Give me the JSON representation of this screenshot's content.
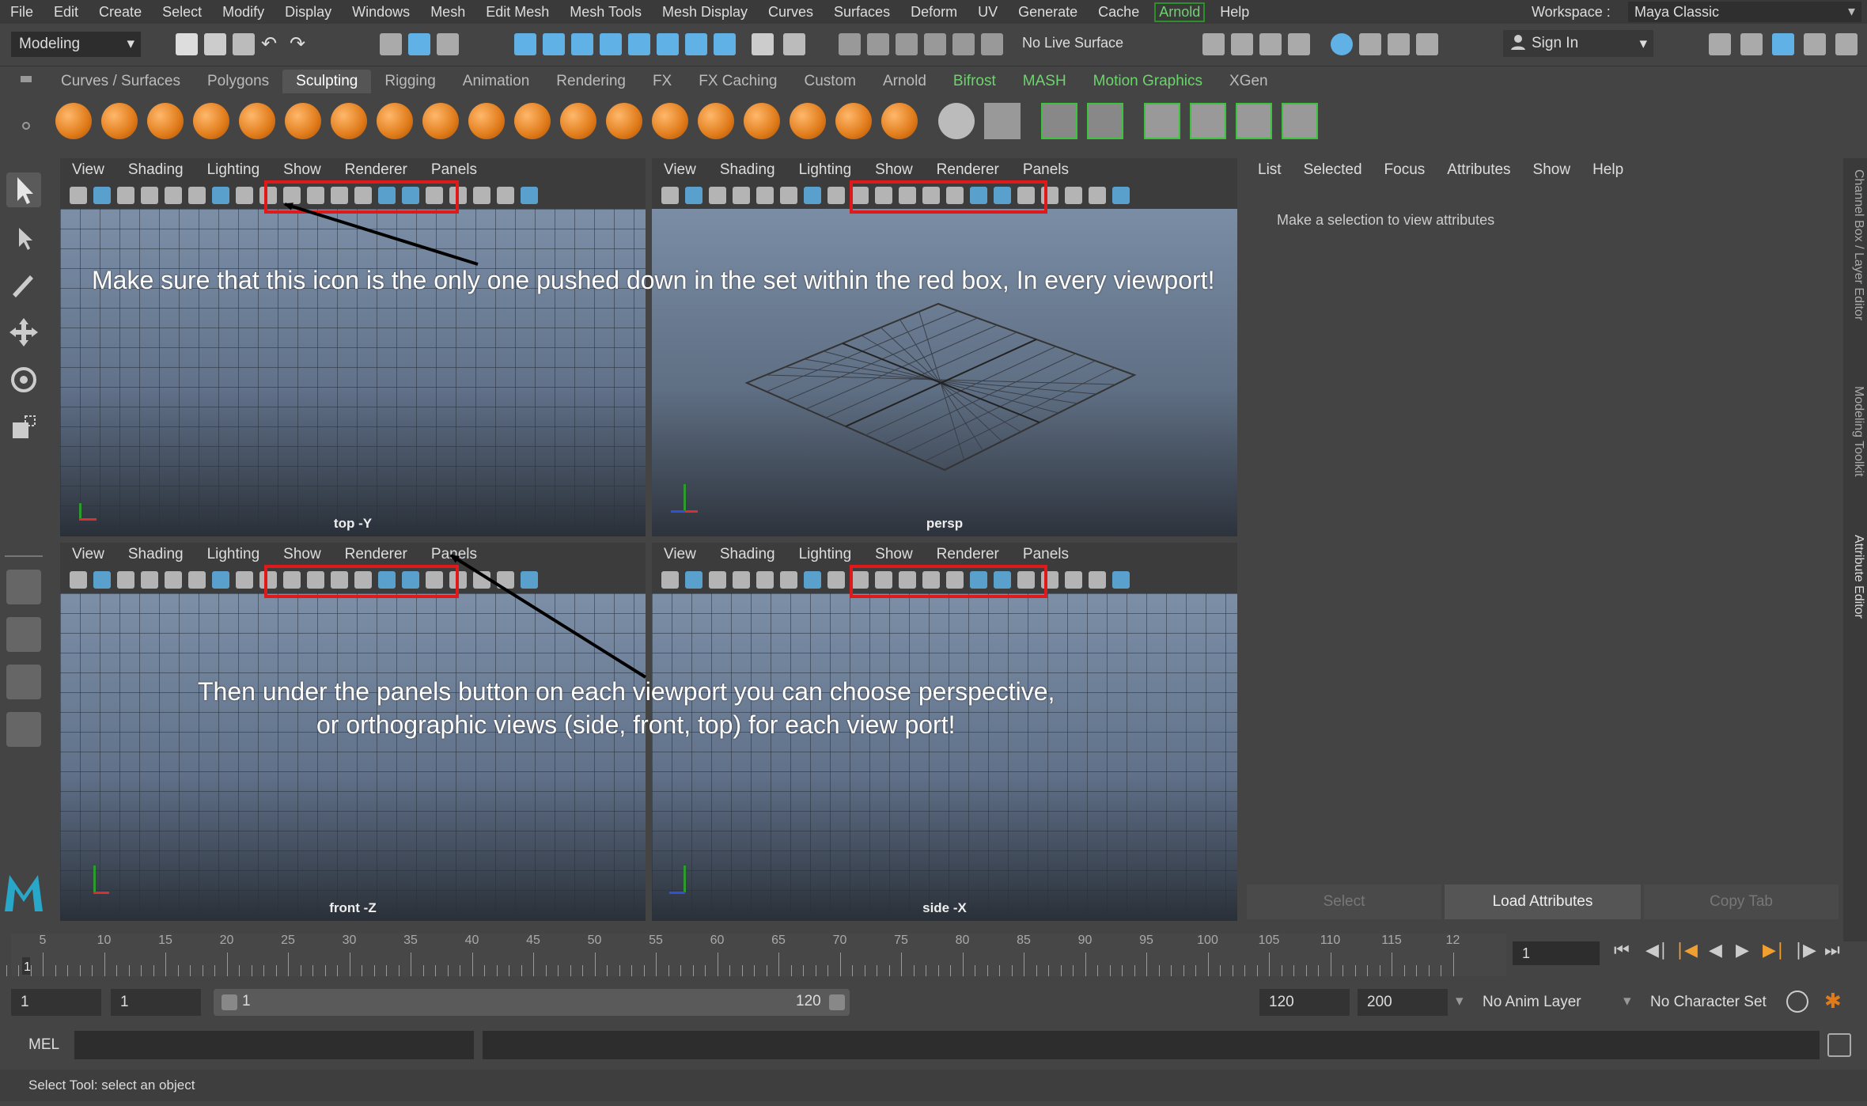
{
  "menubar": {
    "items": [
      "File",
      "Edit",
      "Create",
      "Select",
      "Modify",
      "Display",
      "Windows",
      "Mesh",
      "Edit Mesh",
      "Mesh Tools",
      "Mesh Display",
      "Curves",
      "Surfaces",
      "Deform",
      "UV",
      "Generate",
      "Cache",
      "Arnold",
      "Help"
    ],
    "workspace_label": "Workspace :",
    "workspace_value": "Maya Classic"
  },
  "status_line": {
    "mode": "Modeling",
    "live_surface": "No Live Surface",
    "sign_in": "Sign In"
  },
  "shelf": {
    "tabs": [
      "Curves / Surfaces",
      "Polygons",
      "Sculpting",
      "Rigging",
      "Animation",
      "Rendering",
      "FX",
      "FX Caching",
      "Custom",
      "Arnold",
      "Bifrost",
      "MASH",
      "Motion Graphics",
      "XGen"
    ],
    "active_tab": "Sculpting"
  },
  "viewport_menu": [
    "View",
    "Shading",
    "Lighting",
    "Show",
    "Renderer",
    "Panels"
  ],
  "viewports": {
    "tl": {
      "label": "top -Y"
    },
    "tr": {
      "label": "persp"
    },
    "bl": {
      "label": "front -Z"
    },
    "br": {
      "label": "side -X"
    }
  },
  "attribute_editor": {
    "menu": [
      "List",
      "Selected",
      "Focus",
      "Attributes",
      "Show",
      "Help"
    ],
    "hint": "Make a selection to view attributes",
    "buttons": [
      "Select",
      "Load Attributes",
      "Copy Tab"
    ]
  },
  "side_tabs": [
    "Channel Box / Layer Editor",
    "Modeling Toolkit",
    "Attribute Editor"
  ],
  "time_slider": {
    "ticks": [
      "5",
      "10",
      "15",
      "20",
      "25",
      "30",
      "35",
      "40",
      "45",
      "50",
      "55",
      "60",
      "65",
      "70",
      "75",
      "80",
      "85",
      "90",
      "95",
      "100",
      "105",
      "110",
      "115",
      "12"
    ],
    "current_marker": "1",
    "current_frame": "1"
  },
  "range": {
    "start_time": "1",
    "playback_start": "1",
    "range_start": "1",
    "range_end": "120",
    "playback_end": "120",
    "end_time": "200",
    "anim_layer": "No Anim Layer",
    "character_set": "No Character Set"
  },
  "command_line": {
    "language": "MEL",
    "help": "Select Tool: select an object"
  },
  "annotations": {
    "note1": "Make sure that this icon is the only one pushed down in the set within the red box, In every viewport!",
    "note2_line1": "Then under the panels button on each viewport you can choose perspective,",
    "note2_line2": "or orthographic views (side, front, top) for each view port!"
  },
  "colors": {
    "highlight_box": "#e01a1a",
    "arnold_green": "#6dd46d",
    "shelf_orange": "#e07b1a"
  }
}
